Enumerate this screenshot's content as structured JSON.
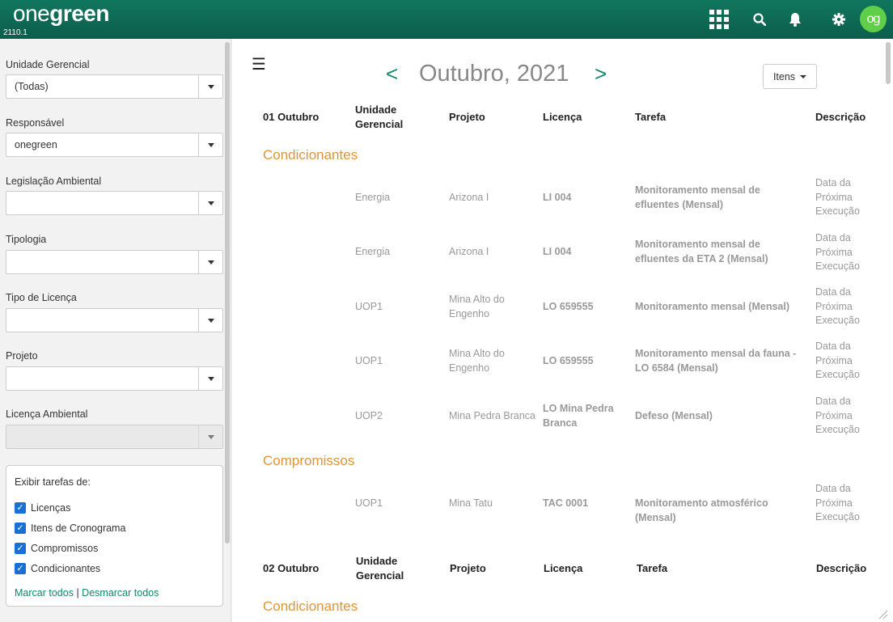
{
  "header": {
    "logo_light": "one",
    "logo_bold": "green",
    "version": "2110.1",
    "avatar_initials": "og",
    "accent_color": "#0b6b55",
    "icons": [
      "apps-grid-icon",
      "search-icon",
      "bell-icon",
      "gear-icon"
    ]
  },
  "sidebar": {
    "fields": [
      {
        "label": "Unidade Gerencial",
        "value": "(Todas)",
        "disabled": false
      },
      {
        "label": "Responsável",
        "value": "onegreen",
        "disabled": false
      },
      {
        "label": "Legislação Ambiental",
        "value": "",
        "disabled": false
      },
      {
        "label": "Tipologia",
        "value": "",
        "disabled": false
      },
      {
        "label": "Tipo de Licença",
        "value": "",
        "disabled": false
      },
      {
        "label": "Projeto",
        "value": "",
        "disabled": false
      },
      {
        "label": "Licença Ambiental",
        "value": "",
        "disabled": true
      }
    ],
    "task_filter": {
      "title": "Exibir tarefas de:",
      "options": [
        {
          "label": "Licenças",
          "checked": true
        },
        {
          "label": "Itens de Cronograma",
          "checked": true
        },
        {
          "label": "Compromissos",
          "checked": true
        },
        {
          "label": "Condicionantes",
          "checked": true
        }
      ],
      "select_all": "Marcar todos",
      "separator": "|",
      "deselect_all": "Desmarcar todos"
    }
  },
  "main": {
    "prev": "<",
    "next": ">",
    "month_title": "Outubro, 2021",
    "itens_button": "Itens",
    "columns": {
      "unidade": "Unidade Gerencial",
      "projeto": "Projeto",
      "licenca": "Licença",
      "tarefa": "Tarefa",
      "descricao": "Descrição"
    },
    "days": [
      {
        "day": "01 Outubro",
        "sections": [
          {
            "title": "Condicionantes",
            "rows": [
              {
                "unidade": "Energia",
                "projeto": "Arizona I",
                "licenca": "LI 004",
                "tarefa": "Monitoramento mensal de efluentes (Mensal)",
                "descricao": "Data da Próxima Execução"
              },
              {
                "unidade": "Energia",
                "projeto": "Arizona I",
                "licenca": "LI 004",
                "tarefa": "Monitoramento mensal de efluentes da ETA 2 (Mensal)",
                "descricao": "Data da Próxima Execução"
              },
              {
                "unidade": "UOP1",
                "projeto": "Mina Alto do Engenho",
                "licenca": "LO 659555",
                "tarefa": "Monitoramento mensal (Mensal)",
                "descricao": "Data da Próxima Execução"
              },
              {
                "unidade": "UOP1",
                "projeto": "Mina Alto do Engenho",
                "licenca": "LO 659555",
                "tarefa": "Monitoramento mensal da fauna - LO 6584 (Mensal)",
                "descricao": "Data da Próxima Execução"
              },
              {
                "unidade": "UOP2",
                "projeto": "Mina Pedra Branca",
                "licenca": "LO Mina Pedra Branca",
                "tarefa": "Defeso (Mensal)",
                "descricao": "Data da Próxima Execução"
              }
            ]
          },
          {
            "title": "Compromissos",
            "rows": [
              {
                "unidade": "UOP1",
                "projeto": "Mina Tatu",
                "licenca": "TAC 0001",
                "tarefa": "Monitoramento atmosférico (Mensal)",
                "descricao": "Data da Próxima Execução"
              }
            ]
          }
        ]
      },
      {
        "day": "02 Outubro",
        "sections": [
          {
            "title": "Condicionantes",
            "rows": []
          }
        ]
      }
    ]
  }
}
